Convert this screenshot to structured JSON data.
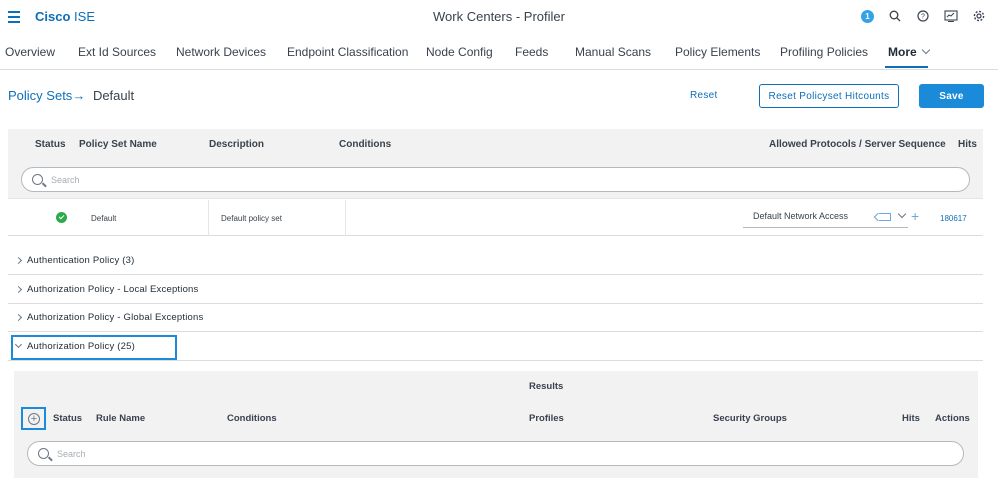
{
  "header": {
    "brand_bold": "Cisco",
    "brand_light": "ISE",
    "title": "Work Centers - Profiler",
    "notification_count": "1",
    "icons": [
      "menu-icon",
      "notification-badge",
      "search-icon",
      "help-icon",
      "dashboard-icon",
      "gear-icon"
    ]
  },
  "nav": {
    "tabs": [
      {
        "label": "Overview"
      },
      {
        "label": "Ext Id Sources"
      },
      {
        "label": "Network Devices"
      },
      {
        "label": "Endpoint Classification"
      },
      {
        "label": "Node Config"
      },
      {
        "label": "Feeds"
      },
      {
        "label": "Manual Scans"
      },
      {
        "label": "Policy Elements"
      },
      {
        "label": "Profiling Policies"
      },
      {
        "label": "More"
      }
    ],
    "active": "More"
  },
  "breadcrumb": {
    "parent": "Policy Sets",
    "current": "Default"
  },
  "actions": {
    "reset": "Reset",
    "reset_hitcounts": "Reset Policyset Hitcounts",
    "save": "Save"
  },
  "policy_set_table": {
    "columns": {
      "status": "Status",
      "name": "Policy Set Name",
      "description": "Description",
      "conditions": "Conditions",
      "protocols": "Allowed Protocols / Server Sequence",
      "hits": "Hits"
    },
    "search_placeholder": "Search",
    "row": {
      "name": "Default",
      "description": "Default policy set",
      "protocol": "Default Network Access",
      "hits": "180617"
    }
  },
  "sections": [
    {
      "label": "Authentication Policy (3)",
      "expanded": false
    },
    {
      "label": "Authorization Policy - Local Exceptions",
      "expanded": false
    },
    {
      "label": "Authorization Policy - Global Exceptions",
      "expanded": false
    },
    {
      "label": "Authorization Policy (25)",
      "expanded": true
    }
  ],
  "authorization_table": {
    "group_header": "Results",
    "columns": {
      "status": "Status",
      "rule_name": "Rule Name",
      "conditions": "Conditions",
      "profiles": "Profiles",
      "security_groups": "Security Groups",
      "hits": "Hits",
      "actions": "Actions"
    },
    "search_placeholder": "Search"
  },
  "colors": {
    "brand_blue": "#0d6fb8",
    "button_blue": "#1b8ad8",
    "status_green": "#2eaa4a",
    "header_gray": "#f2f2f2"
  }
}
